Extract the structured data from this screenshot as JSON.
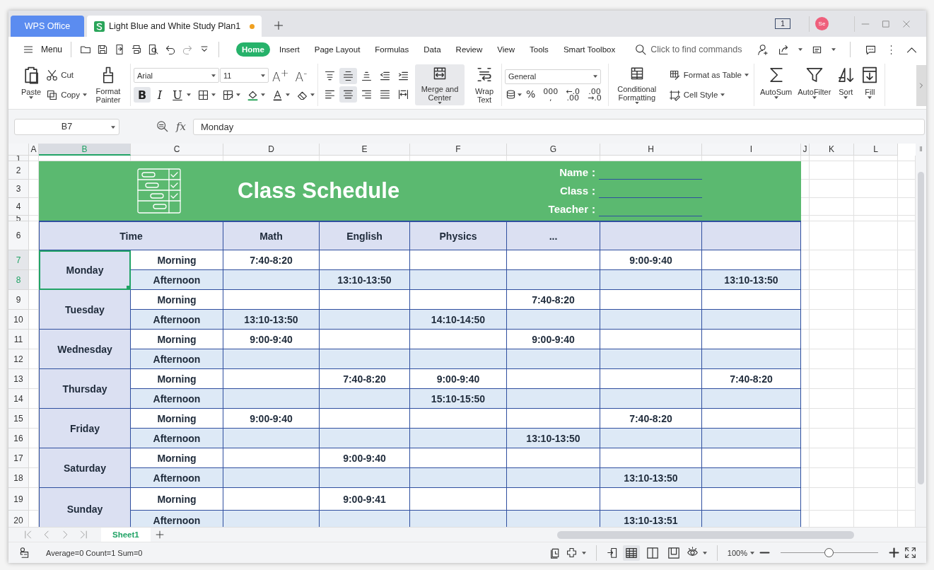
{
  "title_bar": {
    "tabs": [
      {
        "kind": "home",
        "label": "WPS Office",
        "selected": false,
        "unsaved": false
      },
      {
        "kind": "document",
        "label": "Light Blue and White Study Plan1",
        "selected": true,
        "unsaved": true
      }
    ],
    "window_count": "1",
    "avatar": "Se"
  },
  "menu_bar": {
    "menu_label": "Menu",
    "tabs": [
      {
        "label": "Home",
        "selected": true
      },
      {
        "label": "Insert",
        "selected": false
      },
      {
        "label": "Page Layout",
        "selected": false
      },
      {
        "label": "Formulas",
        "selected": false
      },
      {
        "label": "Data",
        "selected": false
      },
      {
        "label": "Review",
        "selected": false
      },
      {
        "label": "View",
        "selected": false
      },
      {
        "label": "Tools",
        "selected": false
      },
      {
        "label": "Smart Toolbox",
        "selected": false
      }
    ],
    "search": {
      "placeholder": "Click to find commands"
    }
  },
  "ribbon": {
    "clipboard": {
      "paste": "Paste",
      "cut": "Cut",
      "copy": "Copy",
      "format_painter": "Format Painter"
    },
    "font": {
      "name": "Arial",
      "size": "11",
      "grow": "A$^{+}$",
      "shrink": "A$^{-}$",
      "styles": [
        {
          "kind": "bold",
          "label": "B",
          "active": true
        },
        {
          "kind": "italic",
          "label": "I",
          "active": false
        },
        {
          "kind": "underline",
          "label": "U",
          "active": false
        }
      ]
    },
    "alignment": {
      "buttons": [
        {
          "kind": "top",
          "active": false
        },
        {
          "kind": "middle",
          "active": true
        },
        {
          "kind": "bottom",
          "active": false
        },
        {
          "kind": "outdent",
          "active": false
        },
        {
          "kind": "indent",
          "active": false
        },
        {
          "kind": "left",
          "active": false
        },
        {
          "kind": "center",
          "active": true
        },
        {
          "kind": "right",
          "active": false
        },
        {
          "kind": "justify",
          "active": false
        },
        {
          "kind": "distributed",
          "active": false
        }
      ],
      "merge_label": "Merge and Center",
      "merged": true,
      "wrap_label": "Wrap Text",
      "wrap": false
    },
    "number": {
      "format": "General",
      "percent": "%",
      "thousands": [
        "000",
        ","
      ],
      "decimal_increase": [
        "←.0",
        ".00"
      ],
      "decimal_decrease": [
        ".00",
        "→.0"
      ]
    },
    "styles": {
      "conditional": "Conditional Formatting",
      "table": "Format as Table",
      "cell_style": "Cell Style"
    },
    "editing": {
      "autosum": "AutoSum",
      "autofilter": "AutoFilter",
      "sort": "Sort",
      "fill": "Fill"
    }
  },
  "formula_bar": {
    "cell_ref": "B7",
    "function_label": "fx",
    "value": "Monday"
  },
  "sheet": {
    "columns": [
      {
        "label": "A",
        "selected": false
      },
      {
        "label": "B",
        "selected": true
      },
      {
        "label": "C",
        "selected": false
      },
      {
        "label": "D",
        "selected": false
      },
      {
        "label": "E",
        "selected": false
      },
      {
        "label": "F",
        "selected": false
      },
      {
        "label": "G",
        "selected": false
      },
      {
        "label": "H",
        "selected": false
      },
      {
        "label": "I",
        "selected": false
      },
      {
        "label": "J",
        "selected": false
      },
      {
        "label": "K",
        "selected": false
      },
      {
        "label": "L",
        "selected": false
      }
    ],
    "rows": [
      {
        "label": "1",
        "selected": false
      },
      {
        "label": "2",
        "selected": false
      },
      {
        "label": "3",
        "selected": false
      },
      {
        "label": "4",
        "selected": false
      },
      {
        "label": "5",
        "selected": false
      },
      {
        "label": "6",
        "selected": false
      },
      {
        "label": "7",
        "selected": true
      },
      {
        "label": "8",
        "selected": true
      },
      {
        "label": "9",
        "selected": false
      },
      {
        "label": "10",
        "selected": false
      },
      {
        "label": "11",
        "selected": false
      },
      {
        "label": "12",
        "selected": false
      },
      {
        "label": "13",
        "selected": false
      },
      {
        "label": "14",
        "selected": false
      },
      {
        "label": "15",
        "selected": false
      },
      {
        "label": "16",
        "selected": false
      },
      {
        "label": "17",
        "selected": false
      },
      {
        "label": "18",
        "selected": false
      },
      {
        "label": "19",
        "selected": false
      },
      {
        "label": "20",
        "selected": false
      }
    ],
    "schedule": {
      "title": "Class Schedule",
      "fields": [
        {
          "label": "Name："
        },
        {
          "label": "Class："
        },
        {
          "label": "Teacher："
        }
      ],
      "header": {
        "time": "Time",
        "subjects": [
          "Math",
          "English",
          "Physics",
          "..."
        ]
      },
      "days": [
        {
          "label": "Monday",
          "selected": true,
          "periods": [
            {
              "label": "Morning",
              "cells": {
                "D": "7:40-8:20",
                "H": "9:00-9:40"
              }
            },
            {
              "label": "Afternoon",
              "cells": {
                "E": "13:10-13:50",
                "I": "13:10-13:50"
              }
            }
          ]
        },
        {
          "label": "Tuesday",
          "selected": false,
          "periods": [
            {
              "label": "Morning",
              "cells": {
                "G": "7:40-8:20"
              }
            },
            {
              "label": "Afternoon",
              "cells": {
                "D": "13:10-13:50",
                "F": "14:10-14:50"
              }
            }
          ]
        },
        {
          "label": "Wednesday",
          "selected": false,
          "periods": [
            {
              "label": "Morning",
              "cells": {
                "D": "9:00-9:40",
                "G": "9:00-9:40"
              }
            },
            {
              "label": "Afternoon"
            }
          ]
        },
        {
          "label": "Thursday",
          "selected": false,
          "periods": [
            {
              "label": "Morning",
              "cells": {
                "E": "7:40-8:20",
                "F": "9:00-9:40",
                "I": "7:40-8:20"
              }
            },
            {
              "label": "Afternoon",
              "cells": {
                "F": "15:10-15:50"
              }
            }
          ]
        },
        {
          "label": "Friday",
          "selected": false,
          "periods": [
            {
              "label": "Morning",
              "cells": {
                "D": "9:00-9:40",
                "H": "7:40-8:20"
              }
            },
            {
              "label": "Afternoon",
              "cells": {
                "G": "13:10-13:50"
              }
            }
          ]
        },
        {
          "label": "Saturday",
          "selected": false,
          "periods": [
            {
              "label": "Morning",
              "cells": {
                "E": "9:00-9:40"
              }
            },
            {
              "label": "Afternoon",
              "cells": {
                "H": "13:10-13:50"
              }
            }
          ]
        },
        {
          "label": "Sunday",
          "selected": false,
          "periods": [
            {
              "label": "Morning",
              "cells": {
                "E": "9:00-9:41"
              }
            },
            {
              "label": "Afternoon",
              "cells": {
                "H": "13:10-13:51"
              }
            }
          ]
        }
      ]
    }
  },
  "sheet_tabs": [
    {
      "label": "Sheet1",
      "selected": true
    }
  ],
  "status_bar": {
    "summary": "Average=0 Count=1 Sum=0",
    "view_modes": [
      {
        "kind": "normal",
        "selected": true
      },
      {
        "kind": "page_break",
        "selected": false
      },
      {
        "kind": "page_layout",
        "selected": false
      }
    ],
    "zoom": "100%",
    "zoom_slider": {
      "level": 0.49
    }
  }
}
